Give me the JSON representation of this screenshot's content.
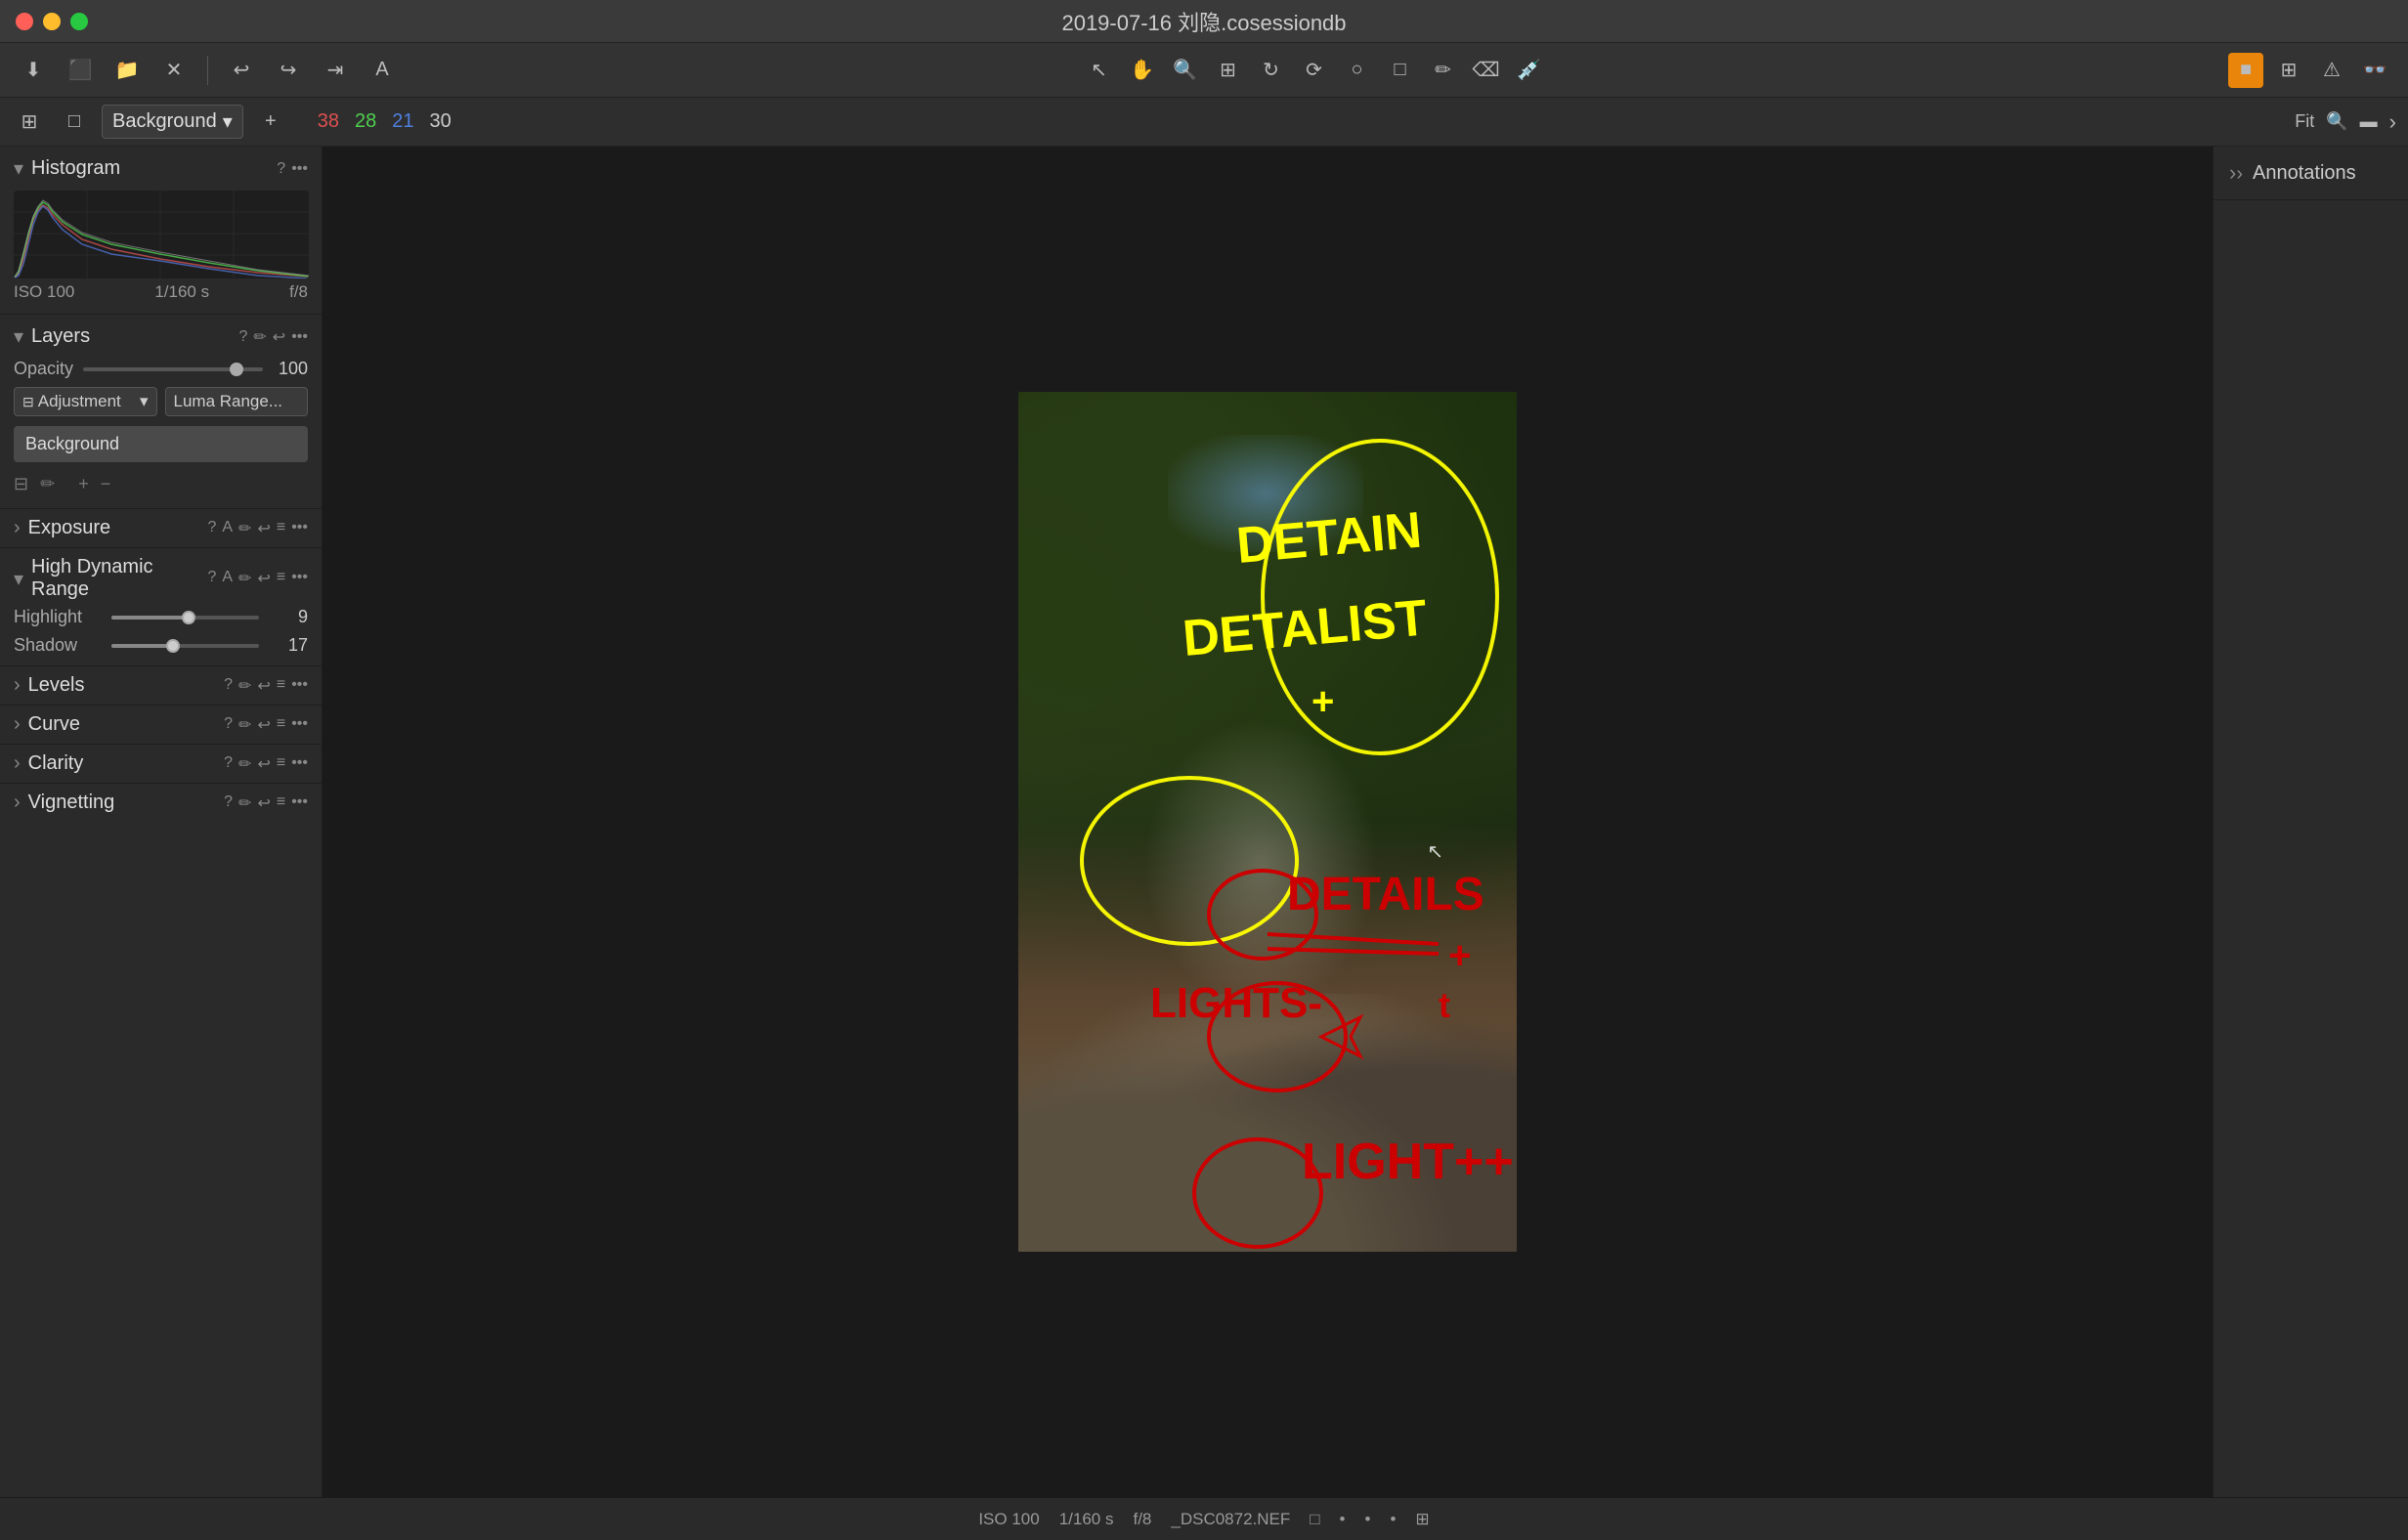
{
  "titlebar": {
    "title": "2019-07-16 刘隐.cosessiondb",
    "traffic": [
      "close",
      "minimize",
      "maximize"
    ]
  },
  "toolbar": {
    "icons": [
      "download",
      "camera",
      "folder",
      "close",
      "undo",
      "redo",
      "forward",
      "text"
    ],
    "center_tools": [
      "select",
      "pan",
      "zoom",
      "crop",
      "rotate",
      "lasso",
      "circle",
      "rect",
      "brush",
      "eraser",
      "eyedropper"
    ],
    "right_tools": [
      "color-picker",
      "grid",
      "warning",
      "glasses"
    ]
  },
  "second_toolbar": {
    "layer_icon1": "grid",
    "layer_icon2": "rect",
    "layer_name": "Background",
    "num_red": "38",
    "num_green": "28",
    "num_blue": "21",
    "num_white": "30",
    "right_label": "Fit"
  },
  "histogram": {
    "title": "Histogram",
    "iso": "ISO 100",
    "shutter": "1/160 s",
    "aperture": "f/8"
  },
  "layers": {
    "title": "Layers",
    "opacity_label": "Opacity",
    "opacity_value": "100",
    "adjustment_label": "Adjustment",
    "luma_label": "Luma Range...",
    "background_layer": "Background"
  },
  "exposure": {
    "title": "Exposure"
  },
  "hdr": {
    "title": "High Dynamic Range",
    "highlight_label": "Highlight",
    "highlight_value": "9",
    "highlight_pct": 52,
    "shadow_label": "Shadow",
    "shadow_value": "17",
    "shadow_pct": 42
  },
  "levels": {
    "title": "Levels"
  },
  "curve": {
    "title": "Curve"
  },
  "clarity": {
    "title": "Clarity"
  },
  "vignetting": {
    "title": "Vignetting"
  },
  "annotations_panel": {
    "title": "Annotations"
  },
  "status_bar": {
    "iso": "ISO 100",
    "shutter": "1/160 s",
    "aperture": "f/8",
    "filename": "_DSC0872.NEF"
  },
  "colors": {
    "accent": "#e8850a",
    "panel_bg": "#2a2a2a",
    "toolbar_bg": "#333333",
    "section_border": "#1e1e1e",
    "yellow_annotation": "#ffff00",
    "red_annotation": "#cc0000"
  }
}
